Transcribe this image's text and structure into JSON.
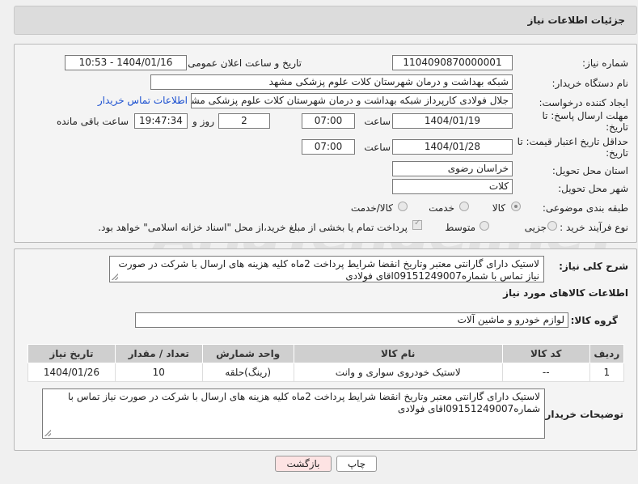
{
  "page": {
    "title": "جزئیات اطلاعات نیاز"
  },
  "form": {
    "need_number_label": "شماره نیاز:",
    "need_number": "1104090870000001",
    "announce_label": "تاریخ و ساعت اعلان عمومی:",
    "announce_value": "1404/01/16 - 10:53",
    "buyer_org_label": "نام دستگاه خریدار:",
    "buyer_org": "شبکه بهداشت و درمان شهرستان کلات   علوم پزشکی مشهد",
    "creator_label": "ایجاد کننده درخواست:",
    "creator": "جلال فولادی کارپرداز شبکه بهداشت و درمان شهرستان کلات   علوم پزشکی مشهد",
    "contact_link": "اطلاعات تماس خریدار",
    "send_deadline_label": "مهلت ارسال پاسخ: تا",
    "send_deadline_label2": "تاریخ:",
    "send_date": "1404/01/19",
    "time_label": "ساعت",
    "send_time": "07:00",
    "days_value": "2",
    "days_label": "روز و",
    "remaining_time": "19:47:34",
    "remaining_label": "ساعت باقی مانده",
    "price_valid_label": "حداقل تاریخ اعتبار قیمت: تا",
    "price_valid_label2": "تاریخ:",
    "price_date": "1404/01/28",
    "price_time": "07:00",
    "province_label": "استان محل تحویل:",
    "province": "خراسان رضوی",
    "city_label": "شهر محل تحویل:",
    "city": "کلات",
    "category_label": "طبقه بندی موضوعی:",
    "category_options": [
      "کالا",
      "خدمت",
      "کالا/خدمت"
    ],
    "category_selected": "کالا",
    "process_label": "نوع فرآیند خرید :",
    "process_options": [
      "جزیی",
      "متوسط"
    ],
    "payment_note": "پرداخت تمام یا بخشی از مبلغ خرید،از محل \"اسناد خزانه اسلامی\" خواهد بود."
  },
  "details": {
    "description_label": "شرح کلی نیاز:",
    "description": "لاستیک دارای گارانتی معتبر وتاریخ انقضا شرایط پرداخت 2ماه کلیه هزینه های ارسال با شرکت در صورت نیاز تماس با شماره09151249007اقای فولادی",
    "goods_info_title": "اطلاعات کالاهای مورد نیاز",
    "goods_group_label": "گروه کالا:",
    "goods_group": "لوازم خودرو و ماشین آلات",
    "table_headers": [
      "ردیف",
      "کد کالا",
      "نام کالا",
      "واحد شمارش",
      "تعداد / مقدار",
      "تاریخ نیاز"
    ],
    "table_rows": [
      [
        "1",
        "--",
        "لاستیک خودروی سواری و وانت",
        "(رینگ)حلقه",
        "10",
        "1404/01/26"
      ]
    ],
    "buyer_notes_label": "توضیحات خریدار:",
    "buyer_notes": "لاستیک دارای گارانتی معتبر وتاریخ انقضا شرایط پرداخت 2ماه کلیه هزینه های ارسال با شرکت در صورت نیاز تماس با شماره09151249007اقای فولادی"
  },
  "buttons": {
    "print": "چاپ",
    "back": "بازگشت"
  },
  "watermark": "AriaTender.neT",
  "colors": {
    "link": "#1a4fd0",
    "back_button": "#fde3e3",
    "print_button": "#ffffff"
  }
}
